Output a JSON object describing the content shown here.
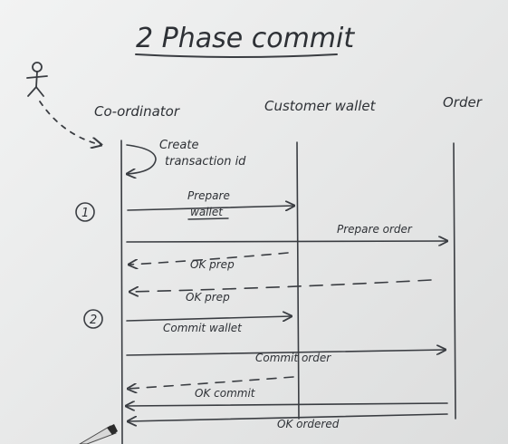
{
  "title": "2 Phase commit",
  "participants": {
    "coordinator": "Co-ordinator",
    "customer_wallet": "Customer wallet",
    "order": "Order"
  },
  "self_note": {
    "line1": "Create",
    "line2": "transaction id"
  },
  "phases": {
    "one": "1",
    "two": "2"
  },
  "messages": {
    "prepare_wallet_line1": "Prepare",
    "prepare_wallet_line2": "wallet",
    "prepare_order": "Prepare order",
    "ok_prep_1": "OK prep",
    "ok_prep_2": "OK prep",
    "commit_wallet": "Commit wallet",
    "commit_order": "Commit order",
    "ok_commit": "OK commit",
    "ok_ordered": "OK ordered"
  },
  "colors": {
    "ink": "#3a3d42",
    "paper": "#eceded"
  }
}
